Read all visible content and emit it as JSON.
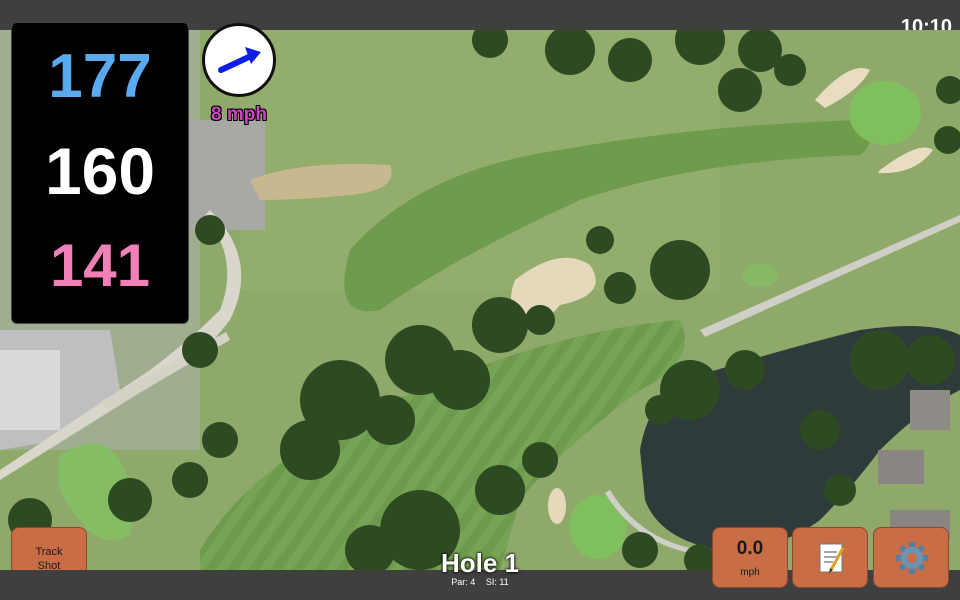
{
  "status_bar": {
    "time": "10:10"
  },
  "distances": {
    "back": {
      "value": "177",
      "color": "#5aaaf0"
    },
    "center": {
      "value": "160",
      "color": "#ffffff"
    },
    "front": {
      "value": "141",
      "color": "#f080b8"
    }
  },
  "wind": {
    "speed_label": "8 mph",
    "direction_icon": "arrow-up-right-icon",
    "arrow_color": "#0d1fe6",
    "label_color": "#d040c8"
  },
  "hole": {
    "title": "Hole 1",
    "par_label": "Par: 4",
    "stroke_index_label": "SI: 11"
  },
  "buttons": {
    "track_shot_line1": "Track",
    "track_shot_line2": "Shot",
    "speed_value": "0.0",
    "speed_unit": "mph",
    "notes_icon": "memo-icon",
    "settings_icon": "gear-icon"
  },
  "colors": {
    "button_bg": "#c86d45",
    "bar_bg": "#3f3f3f",
    "panel_bg": "#000000"
  }
}
